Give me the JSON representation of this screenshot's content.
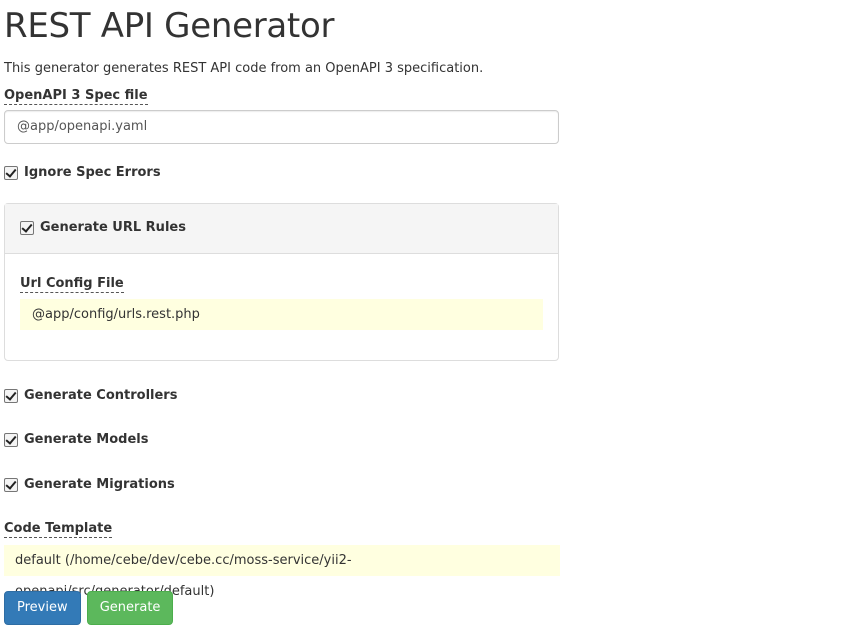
{
  "page": {
    "title": "REST API Generator",
    "description": "This generator generates REST API code from an OpenAPI 3 specification."
  },
  "form": {
    "spec_file": {
      "label": "OpenAPI 3 Spec file",
      "value": "@app/openapi.yaml"
    },
    "ignore_spec_errors": {
      "label": "Ignore Spec Errors",
      "checked": true
    },
    "url_rules": {
      "label": "Generate URL Rules",
      "checked": true,
      "config_file": {
        "label": "Url Config File",
        "value": "@app/config/urls.rest.php"
      }
    },
    "generate_controllers": {
      "label": "Generate Controllers",
      "checked": true
    },
    "generate_models": {
      "label": "Generate Models",
      "checked": true
    },
    "generate_migrations": {
      "label": "Generate Migrations",
      "checked": true
    },
    "code_template": {
      "label": "Code Template",
      "value": "default (/home/cebe/dev/cebe.cc/moss-service/yii2-openapi/src/generator/default)"
    }
  },
  "buttons": {
    "preview": "Preview",
    "generate": "Generate"
  },
  "colors": {
    "primary": "#337ab7",
    "success": "#5cb85c",
    "sticky_bg": "#ffffe0",
    "panel_heading_bg": "#f5f5f5"
  }
}
